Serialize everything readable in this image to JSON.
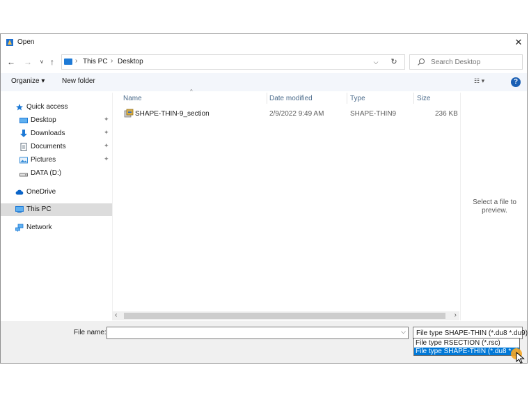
{
  "window": {
    "title": "Open",
    "close_glyph": "✕"
  },
  "nav": {
    "back": "←",
    "forward": "→",
    "recent": "˅",
    "up": "↑"
  },
  "address": {
    "crumbs": [
      "This PC",
      "Desktop"
    ],
    "separator": "›",
    "dropdown_glyph": "⌵",
    "refresh_glyph": "↻"
  },
  "search": {
    "placeholder": "Search Desktop"
  },
  "toolbar": {
    "organize": "Organize ▾",
    "new_folder": "New folder",
    "view": "☷ ▾",
    "help": "?"
  },
  "sidebar": {
    "items": [
      {
        "label": "Quick access",
        "icon": "star-icon",
        "color": "#1e7ad6"
      },
      {
        "label": "Desktop",
        "icon": "desktop-folder-icon",
        "color": "#1e7ad6"
      },
      {
        "label": "Downloads",
        "icon": "download-arrow-icon",
        "color": "#1e7ad6"
      },
      {
        "label": "Documents",
        "icon": "document-icon",
        "color": "#607080"
      },
      {
        "label": "Pictures",
        "icon": "picture-icon",
        "color": "#3a8fd8"
      },
      {
        "label": "DATA (D:)",
        "icon": "drive-icon",
        "color": "#555555"
      },
      {
        "label": "OneDrive",
        "icon": "cloud-icon",
        "color": "#0a64c8"
      },
      {
        "label": "This PC",
        "icon": "computer-icon",
        "color": "#1e7ad6"
      },
      {
        "label": "Network",
        "icon": "network-icon",
        "color": "#1e7ad6"
      }
    ],
    "pin_glyph": "📌"
  },
  "columns": {
    "name": "Name",
    "date": "Date modified",
    "type": "Type",
    "size": "Size",
    "sort_glyph": "^"
  },
  "files": [
    {
      "name": "SHAPE-THIN-9_section",
      "date": "2/9/2022 9:49 AM",
      "type": "SHAPE-THIN9",
      "size": "236 KB"
    }
  ],
  "preview": {
    "line1": "Select a file to",
    "line2": "preview."
  },
  "scroll": {
    "left": "‹",
    "right": "›"
  },
  "bottom": {
    "file_name_label": "File name:",
    "file_name_value": "",
    "dropdown_glyph": "⌵",
    "file_type_selected": "File type SHAPE-THIN (*.du8 *.du9)",
    "file_type_options": [
      "File type RSECTION (*.rsc)",
      "File type SHAPE-THIN (*.du8 *.du9)"
    ]
  },
  "colors": {
    "accent": "#0078d7",
    "toolbar_bg": "#f3f6fb",
    "selected_bg": "#dcdcdc",
    "cursor_highlight": "#f5a623"
  }
}
